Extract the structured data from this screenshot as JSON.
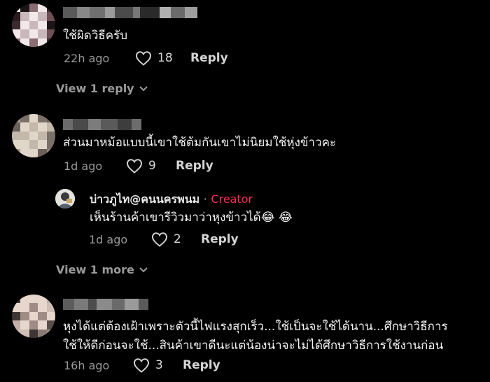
{
  "comments": [
    {
      "text": "ใช้ผิดวิธีครับ",
      "time": "22h ago",
      "likes": "18",
      "reply_label": "Reply",
      "view_replies_label": "View 1 reply"
    },
    {
      "text": "ส่วนมาหม้อแบบนี้เขาใช้ต้มกันเขาไม่นิยมใช้หุ่งข้าวคะ",
      "time": "1d ago",
      "likes": "9",
      "reply_label": "Reply",
      "view_replies_label": "View 1 more",
      "reply": {
        "author": "บ่าวภูไท@คนนครพนม",
        "separator": "·",
        "badge": "Creator",
        "text": "เห็นร้านค้าเขารีวิวมาว่าหุงข้าวได้😂 😂",
        "time": "1d ago",
        "likes": "2",
        "reply_label": "Reply"
      }
    },
    {
      "text_line1": "หุงได้แต่ต้องเฝ้าเพราะตัวนี้ไฟแรงสุกเร็ว...ใช้เป็นจะใช้ได้นาน...ศึกษาวิธีการ",
      "text_line2": "ใช้ให้ดีก่อนจะใช้...สินค้าเขาดีนะแต่น้องน่าจะไม่ได้ศึกษาวิธีการใช้งานก่อน",
      "time": "16h ago",
      "likes": "3",
      "reply_label": "Reply"
    }
  ],
  "colors": {
    "background": "#000000",
    "text": "#f2f2f2",
    "muted": "#9a9a9a",
    "creator_badge": "#fe2c55"
  },
  "icons": {
    "like": "heart-outline-icon",
    "expand": "chevron-down-icon"
  }
}
